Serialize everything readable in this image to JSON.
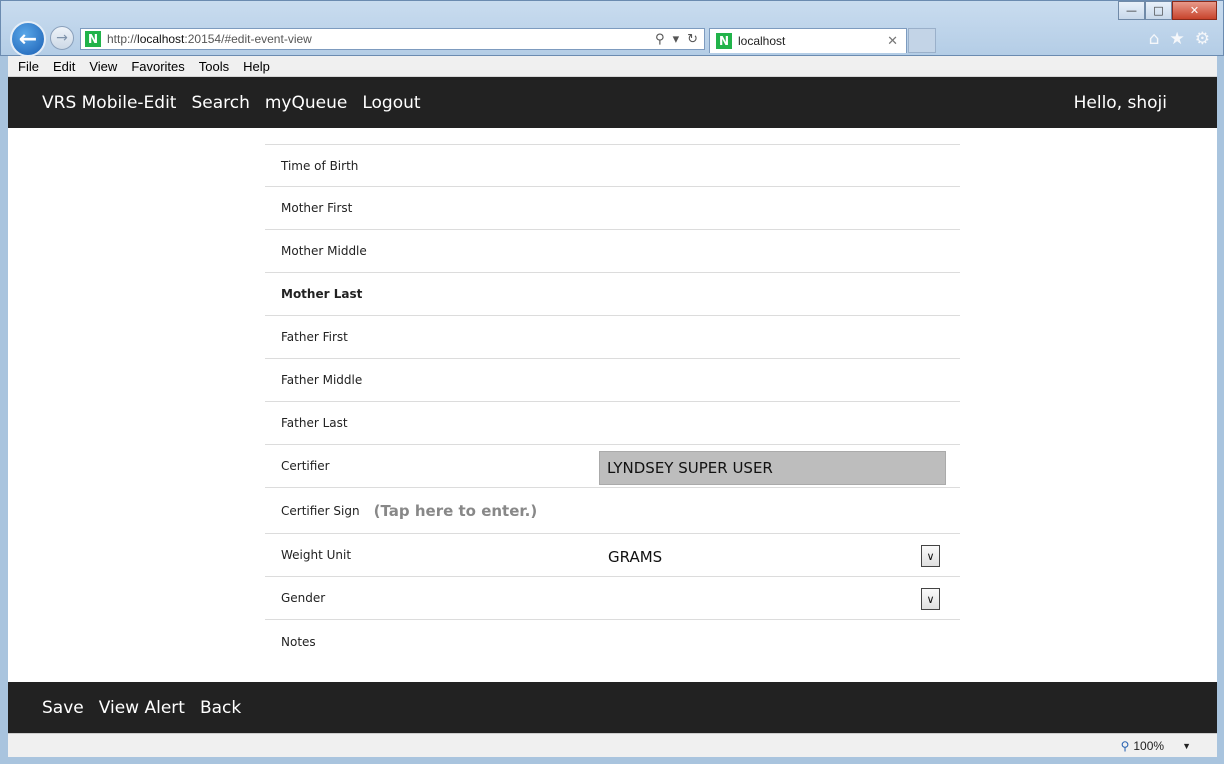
{
  "browser": {
    "url_prefix": "http://",
    "url_host": "localhost",
    "url_rest": ":20154/#edit-event-view",
    "tab_title": "localhost",
    "favicon_letter": "N",
    "menu": [
      "File",
      "Edit",
      "View",
      "Favorites",
      "Tools",
      "Help"
    ],
    "zoom": "100%"
  },
  "header": {
    "brand": "VRS Mobile-Edit",
    "links": [
      "Search",
      "myQueue",
      "Logout"
    ],
    "greeting": "Hello, shoji"
  },
  "form": {
    "rows": [
      {
        "label": "Time of Birth"
      },
      {
        "label": "Mother First"
      },
      {
        "label": "Mother Middle"
      },
      {
        "label": "Mother Last"
      },
      {
        "label": "Father First"
      },
      {
        "label": "Father Middle"
      },
      {
        "label": "Father Last"
      },
      {
        "label": "Certifier",
        "value": "LYNDSEY SUPER USER"
      },
      {
        "label": "Certifier Sign",
        "note": "(Tap here to enter.)"
      },
      {
        "label": "Weight Unit",
        "value": "GRAMS"
      },
      {
        "label": "Gender",
        "value": ""
      },
      {
        "label": "Notes"
      }
    ]
  },
  "footer": {
    "links": [
      "Save",
      "View Alert",
      "Back"
    ]
  }
}
